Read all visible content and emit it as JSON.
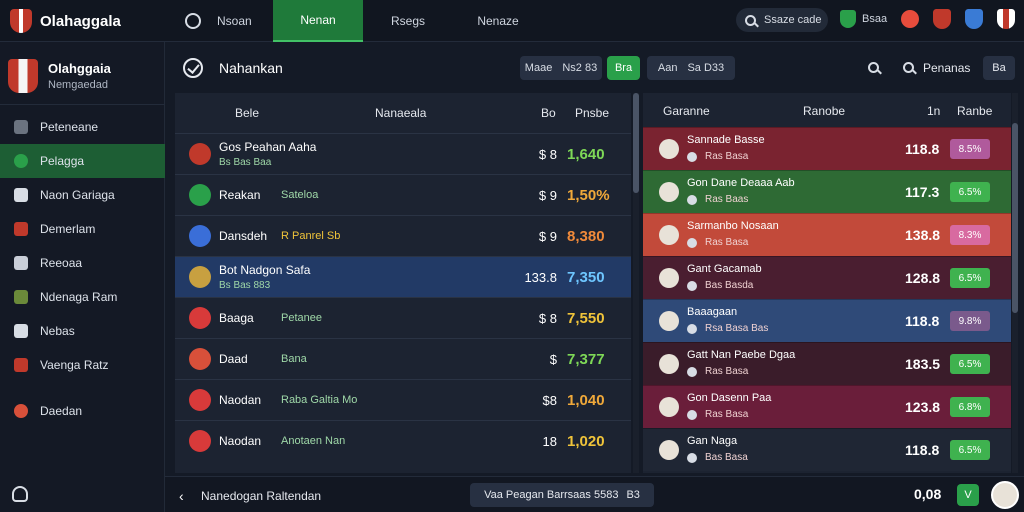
{
  "app": {
    "title": "Olahaggala"
  },
  "nav": {
    "tabs": [
      {
        "label": "Nsoan",
        "active": false
      },
      {
        "label": "Nenan",
        "active": true
      },
      {
        "label": "Rsegs",
        "active": false
      },
      {
        "label": "Nenaze",
        "active": false
      }
    ]
  },
  "search": {
    "label": "Ssaze cade"
  },
  "top_badge": {
    "text": "Bsaa"
  },
  "club": {
    "name": "Olahggaia",
    "subtitle": "Nemgaedad"
  },
  "sidebar": {
    "items": [
      {
        "label": "Peteneane",
        "icon": "document-icon",
        "active": false
      },
      {
        "label": "Pelagga",
        "icon": "ball-icon",
        "active": true
      },
      {
        "label": "Naon Gariaga",
        "icon": "jersey-icon",
        "active": false
      },
      {
        "label": "Demerlam",
        "icon": "shield-icon",
        "active": false
      },
      {
        "label": "Reeoaa",
        "icon": "shield-icon",
        "active": false
      },
      {
        "label": "Ndenaga Ram",
        "icon": "trophy-icon",
        "active": false
      },
      {
        "label": "Nebas",
        "icon": "star-icon",
        "active": false
      },
      {
        "label": "Vaenga Ratz",
        "icon": "crest-icon",
        "active": false
      },
      {
        "label": "Daedan",
        "icon": "ball-icon",
        "active": false
      }
    ]
  },
  "header": {
    "title": "Nahankan",
    "filter1": {
      "a": "Maae",
      "b": "Ns2 83"
    },
    "filter_active": "Bra",
    "filter2": {
      "a": "Aan",
      "b": "Sa D33"
    },
    "right_label": "Penanas",
    "right_btn": "Ba"
  },
  "left_table": {
    "headers": {
      "col1": "Bele",
      "col2": "Nanaeala",
      "col3": "Bo",
      "col4": "Pnsbe"
    },
    "rows": [
      {
        "name": "Gos Peahan Aaha",
        "sub": "Bs Bas Baa",
        "form": "",
        "a": "$ 8",
        "b": "1,640",
        "color": "#7ed957",
        "crest": "#c0392b",
        "hl": false,
        "two_line": true
      },
      {
        "name": "Reakan",
        "sub": "",
        "form": "Sateloa",
        "a": "$ 9",
        "b": "1,50%",
        "color": "#f0a93a",
        "crest": "#2aa04a",
        "hl": false,
        "two_line": false
      },
      {
        "name": "Dansdeh",
        "sub": "",
        "form": "R Panrel Sb",
        "a": "$ 9",
        "b": "8,380",
        "color": "#f08a3a",
        "crest": "#3a6ed8",
        "hl": false,
        "two_line": false
      },
      {
        "name": "Bot Nadgon Safa",
        "sub": "Bs Bas 883",
        "form": "",
        "a": "133.8",
        "b": "7,350",
        "color": "#6ec6ff",
        "crest": "#c8a040",
        "hl": true,
        "two_line": true
      },
      {
        "name": "Baaga",
        "sub": "",
        "form": "Petanee",
        "a": "$ 8",
        "b": "7,550",
        "color": "#f0c43a",
        "crest": "#d83a3a",
        "hl": false,
        "two_line": false
      },
      {
        "name": "Daad",
        "sub": "",
        "form": "Bana",
        "a": "$",
        "b": "7,377",
        "color": "#7ed957",
        "crest": "#d8503a",
        "hl": false,
        "two_line": false
      },
      {
        "name": "Naodan",
        "sub": "",
        "form": "Raba Galtia Mo",
        "a": "$8",
        "b": "1,040",
        "color": "#f0a93a",
        "crest": "#d83a3a",
        "hl": false,
        "two_line": false
      },
      {
        "name": "Naodan",
        "sub": "",
        "form": "Anotaen Nan",
        "a": "18",
        "b": "1,020",
        "color": "#f0c43a",
        "crest": "#d83a3a",
        "hl": false,
        "two_line": false
      }
    ]
  },
  "right_table": {
    "headers": {
      "col1": "Garanne",
      "col2": "Ranobe",
      "col3": "1n",
      "col4": "Ranbe"
    },
    "rows": [
      {
        "name": "Sannade Basse",
        "sub": "Ras Basa",
        "val": "118.8",
        "badge": "8.5%",
        "bg": "#7a2330",
        "badge_bg": "#b05a9c"
      },
      {
        "name": "Gon Dane Deaaa Aab",
        "sub": "Ras Baas",
        "val": "117.3",
        "badge": "6.5%",
        "bg": "#2e6a34",
        "badge_bg": "#3fb24f"
      },
      {
        "name": "Sarmanbo Nosaan",
        "sub": "Ras Basa",
        "val": "138.8",
        "badge": "8.3%",
        "bg": "#c24a3a",
        "badge_bg": "#d86aa0"
      },
      {
        "name": "Gant Gacamab",
        "sub": "Bas Basda",
        "val": "128.8",
        "badge": "6.5%",
        "bg": "#4a1e30",
        "badge_bg": "#3fb24f"
      },
      {
        "name": "Baaagaan",
        "sub": "Rsa Basa Bas",
        "val": "118.8",
        "badge": "9.8%",
        "bg": "#2f4a78",
        "badge_bg": "#7a5a8c"
      },
      {
        "name": "Gatt Nan Paebe Dgaa",
        "sub": "Ras Basa",
        "val": "183.5",
        "badge": "6.5%",
        "bg": "#3a1c2a",
        "badge_bg": "#3fb24f"
      },
      {
        "name": "Gon Dasenn Paa",
        "sub": "Ras Basa",
        "val": "123.8",
        "badge": "6.8%",
        "bg": "#6a1e3a",
        "badge_bg": "#3fb24f"
      },
      {
        "name": "Gan Naga",
        "sub": "Bas Basa",
        "val": "118.8",
        "badge": "6.5%",
        "bg": "#1f2634",
        "badge_bg": "#3fb24f"
      }
    ]
  },
  "footer": {
    "text": "Nanedogan Raltendan",
    "pill_a": "Vaa Peagan Barrsaas 5583",
    "pill_b": "B3",
    "value": "0,08",
    "btn": "V"
  }
}
